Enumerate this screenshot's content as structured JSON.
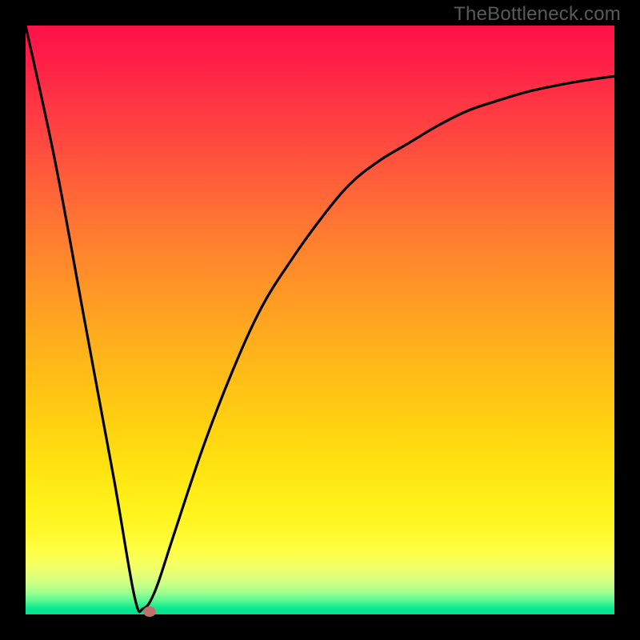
{
  "watermark": "TheBottleneck.com",
  "colors": {
    "frame": "#000000",
    "curve": "#000000",
    "marker": "#bd736a"
  },
  "chart_data": {
    "type": "line",
    "title": "",
    "xlabel": "",
    "ylabel": "",
    "xlim": [
      0,
      100
    ],
    "ylim": [
      0,
      100
    ],
    "grid": false,
    "series": [
      {
        "name": "bottleneck-curve",
        "x": [
          0,
          5,
          10,
          15,
          18.5,
          20,
          22,
          25,
          30,
          35,
          40,
          45,
          50,
          55,
          60,
          65,
          70,
          75,
          80,
          85,
          90,
          95,
          100
        ],
        "values": [
          100,
          77,
          50,
          23,
          3,
          1,
          4,
          13,
          28,
          41,
          52,
          60,
          67,
          73,
          77,
          80,
          83,
          85.5,
          87.2,
          88.7,
          89.8,
          90.7,
          91.4
        ]
      }
    ],
    "markers": [
      {
        "name": "optimal-point",
        "x": 21,
        "y": 0.5
      }
    ],
    "background_gradient": [
      {
        "pos": 0,
        "color": "#ff1249"
      },
      {
        "pos": 50,
        "color": "#ffaa1e"
      },
      {
        "pos": 88,
        "color": "#fffe43"
      },
      {
        "pos": 100,
        "color": "#00e28e"
      }
    ]
  }
}
